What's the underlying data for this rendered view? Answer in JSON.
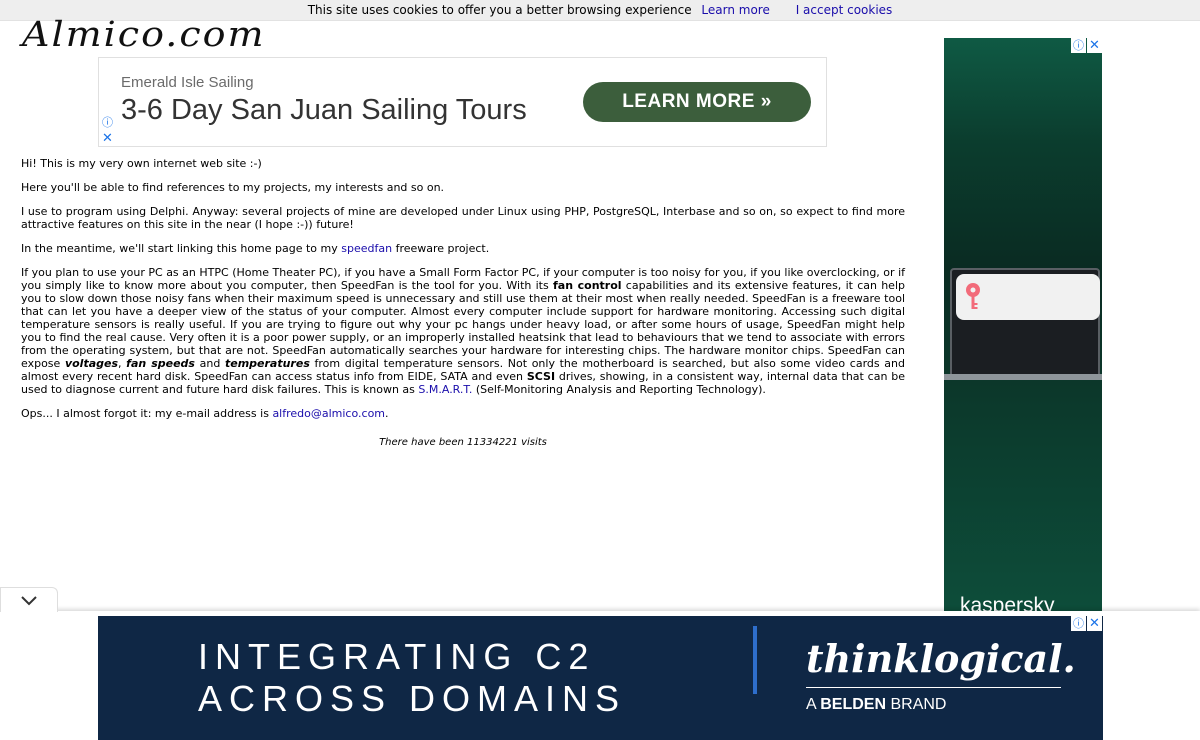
{
  "cookie_bar": {
    "message": "This site uses cookies to offer you a better browsing experience",
    "learn_more": "Learn more",
    "accept": "I accept cookies"
  },
  "logo": {
    "text": "Almico.com"
  },
  "top_ad": {
    "brand": "Emerald Isle Sailing",
    "headline": "3-6 Day San Juan Sailing Tours",
    "cta": "LEARN MORE »"
  },
  "ad_icons": {
    "info": "ⓘ",
    "close": "✕"
  },
  "content": {
    "p1": "Hi! This is my very own internet web site :-)",
    "p2": "Here you'll be able to find references to my projects, my interests and so on.",
    "p3": "I use to program using Delphi. Anyway: several projects of mine are developed under Linux using PHP, PostgreSQL, Interbase and so on, so expect to find more attractive features on this site in the near (I hope :-)) future!",
    "p4_a": "In the meantime, we'll start linking this home page to my ",
    "p4_link": "speedfan",
    "p4_b": " freeware project.",
    "p5_a": "If you plan to use your PC as an HTPC (Home Theater PC), if you have a Small Form Factor PC, if your computer is too noisy for you, if you like overclocking, or if you simply like to know more about you computer, then SpeedFan is the tool for you. With its ",
    "p5_fan_control": "fan control",
    "p5_b": " capabilities and its extensive features, it can help you to slow down those noisy fans when their maximum speed is unnecessary and still use them at their most when really needed. SpeedFan is a freeware tool that can let you have a deeper view of the status of your computer. Almost every computer include support for hardware monitoring. Accessing such digital temperature sensors is really useful. If you are trying to figure out why your pc hangs under heavy load, or after some hours of usage, SpeedFan might help you to find the real cause. Very often it is a poor power supply, or an improperly installed heatsink that lead to behaviours that we tend to associate with errors from the operating system, but that are not. SpeedFan automatically searches your hardware for interesting chips. The hardware monitor chips. SpeedFan can expose ",
    "p5_voltages": "voltages",
    "p5_c": ", ",
    "p5_fan_speeds": "fan speeds",
    "p5_d": " and ",
    "p5_temperatures": "temperatures",
    "p5_e": " from digital temperature sensors. Not only the motherboard is searched, but also some video cards and almost every recent hard disk. SpeedFan can access status info from EIDE, SATA and even ",
    "p5_scsi": "SCSI",
    "p5_f": " drives, showing, in a consistent way, internal data that can be used to diagnose current and future hard disk failures. This is known as ",
    "p5_smart": "S.M.A.R.T.",
    "p5_g": " (Self-Monitoring Analysis and Reporting Technology).",
    "p6_a": "Ops... I almost forgot it: my e-mail address is ",
    "p6_email": "alfredo@almico.com",
    "p6_b": ".",
    "visits": "There have been 11334221 visits"
  },
  "right_ad": {
    "brand": "kaspersky"
  },
  "bottom_ad": {
    "line1": "INTEGRATING C2",
    "line2": "ACROSS DOMAINS",
    "brand": "thinklogical.",
    "sub_a": "A ",
    "sub_bold": "BELDEN",
    "sub_b": " BRAND"
  },
  "colors": {
    "link": "#1a0dab",
    "cta_green": "#3c5e3c",
    "bottom_ad_bg": "#0f2745",
    "right_ad_bg": "#0b3d2e"
  }
}
